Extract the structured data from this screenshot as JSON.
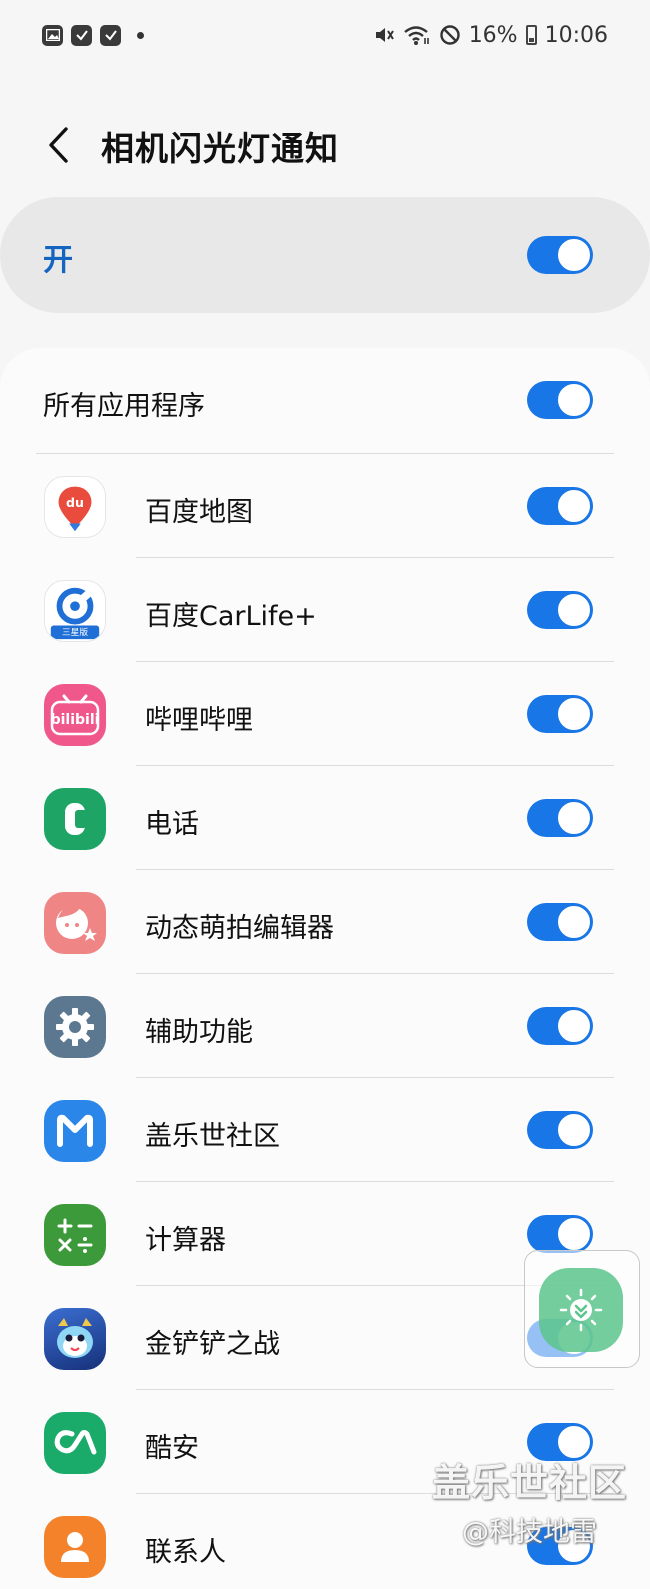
{
  "status_bar": {
    "battery": "16%",
    "time": "10:06",
    "left_icons": [
      "image-icon",
      "check-notification-icon",
      "check-notification-icon"
    ],
    "right_icons": [
      "mute-icon",
      "wifi-icon",
      "dnd-icon",
      "battery-icon"
    ]
  },
  "header": {
    "title": "相机闪光灯通知",
    "back_icon": "chevron-left-icon"
  },
  "master": {
    "label": "开",
    "enabled": true
  },
  "all_apps": {
    "label": "所有应用程序",
    "enabled": true
  },
  "apps": [
    {
      "name": "百度地图",
      "icon": "baidu-map-icon",
      "enabled": true
    },
    {
      "name": "百度CarLife+",
      "icon": "baidu-carlife-icon",
      "icon_caption": "三星版",
      "enabled": true
    },
    {
      "name": "哔哩哔哩",
      "icon": "bilibili-icon",
      "icon_caption": "bilibili",
      "enabled": true
    },
    {
      "name": "电话",
      "icon": "phone-icon",
      "enabled": true
    },
    {
      "name": "动态萌拍编辑器",
      "icon": "ar-emoji-editor-icon",
      "enabled": true
    },
    {
      "name": "辅助功能",
      "icon": "accessibility-gear-icon",
      "enabled": true
    },
    {
      "name": "盖乐世社区",
      "icon": "samsung-members-icon",
      "enabled": true
    },
    {
      "name": "计算器",
      "icon": "calculator-icon",
      "enabled": true
    },
    {
      "name": "金铲铲之战",
      "icon": "jinchanchan-game-icon",
      "enabled": true
    },
    {
      "name": "酷安",
      "icon": "coolapk-icon",
      "enabled": true
    },
    {
      "name": "联系人",
      "icon": "contacts-icon",
      "enabled": true
    }
  ],
  "watermark": {
    "line1": "盖乐世社区",
    "line2": "@科技地雷"
  },
  "colors": {
    "accent": "#1976e6",
    "master_label": "#1565c0",
    "baidu_map": "#e94b3c",
    "carlife": "#1f6fd6",
    "bilibili": "#f0588c",
    "phone": "#1ea566",
    "ar_emoji": "#ef8585",
    "accessibility": "#5c7790",
    "samsung_members": "#2a86e8",
    "calculator": "#3d9a3a",
    "coolapk": "#1aaa6a",
    "contacts": "#f4822a"
  }
}
